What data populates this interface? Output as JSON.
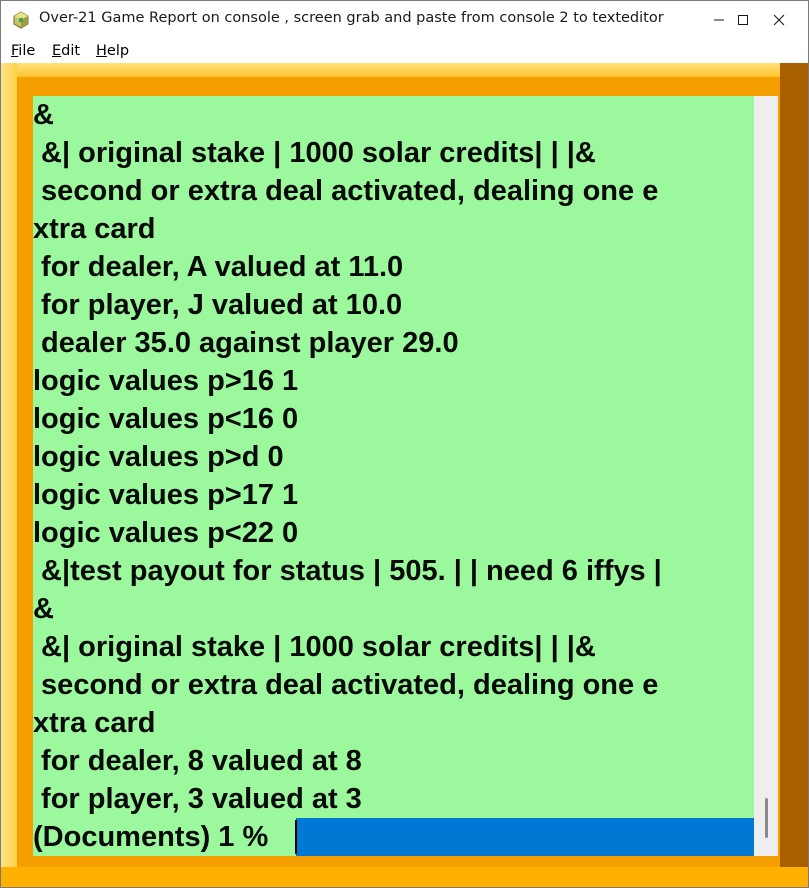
{
  "window": {
    "title": "Over-21 Game Report on console , screen grab and paste from console 2 to texteditor",
    "icon": "cube-app-icon",
    "controls": [
      "minimize-icon",
      "maximize-icon",
      "close-icon"
    ]
  },
  "menu": {
    "file": {
      "accel": "F",
      "rest": "ile"
    },
    "edit": {
      "accel": "E",
      "rest": "dit"
    },
    "help": {
      "accel": "H",
      "rest": "elp"
    }
  },
  "console": {
    "background": "#9cf89c",
    "selection_color": "#0078d4",
    "lines": [
      "&",
      " &| original stake | 1000 solar credits| | |&",
      " second or extra deal activated, dealing one e",
      "xtra card",
      " for dealer, A valued at 11.0",
      " for player, J valued at 10.0",
      " dealer 35.0 against player 29.0",
      "logic values p>16 1",
      "logic values p<16 0",
      "logic values p>d 0",
      "logic values p>17 1",
      "logic values p<22 0",
      " &|test payout for status | 505. | | need 6 iffys |",
      "&",
      " &| original stake | 1000 solar credits| | |&",
      " second or extra deal activated, dealing one e",
      "xtra card",
      " for dealer, 8 valued at 8",
      " for player, 3 valued at 3",
      "(Documents) 1 %"
    ]
  },
  "frame_colors": {
    "outer": "#ffb000",
    "shadow": "#a85f00"
  }
}
